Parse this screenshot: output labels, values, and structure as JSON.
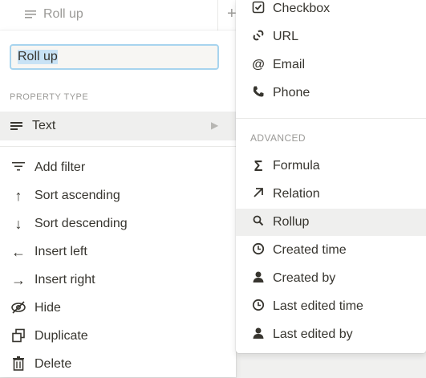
{
  "header": {
    "column_name": "Roll up",
    "add_column": "+"
  },
  "property_editor": {
    "name_value": "Roll up",
    "property_type_label": "PROPERTY TYPE",
    "current_type": "Text",
    "actions": [
      {
        "label": "Add filter",
        "icon": "filter-icon"
      },
      {
        "label": "Sort ascending",
        "icon": "arrow-up-icon"
      },
      {
        "label": "Sort descending",
        "icon": "arrow-down-icon"
      },
      {
        "label": "Insert left",
        "icon": "arrow-left-icon"
      },
      {
        "label": "Insert right",
        "icon": "arrow-right-icon"
      },
      {
        "label": "Hide",
        "icon": "eye-off-icon"
      },
      {
        "label": "Duplicate",
        "icon": "duplicate-icon"
      },
      {
        "label": "Delete",
        "icon": "trash-icon"
      }
    ]
  },
  "type_menu": {
    "basic": [
      {
        "label": "Checkbox",
        "icon": "checkbox-icon"
      },
      {
        "label": "URL",
        "icon": "link-icon"
      },
      {
        "label": "Email",
        "icon": "at-icon"
      },
      {
        "label": "Phone",
        "icon": "phone-icon"
      }
    ],
    "advanced_label": "ADVANCED",
    "advanced": [
      {
        "label": "Formula",
        "icon": "sigma-icon"
      },
      {
        "label": "Relation",
        "icon": "arrow-up-right-icon"
      },
      {
        "label": "Rollup",
        "icon": "search-icon",
        "selected": true
      },
      {
        "label": "Created time",
        "icon": "clock-icon"
      },
      {
        "label": "Created by",
        "icon": "person-icon"
      },
      {
        "label": "Last edited time",
        "icon": "clock-icon"
      },
      {
        "label": "Last edited by",
        "icon": "person-icon"
      }
    ]
  },
  "colors": {
    "highlight": "#efefee",
    "focus_ring": "#a7d4ee",
    "muted": "#9b9a97",
    "text": "#37352f"
  }
}
